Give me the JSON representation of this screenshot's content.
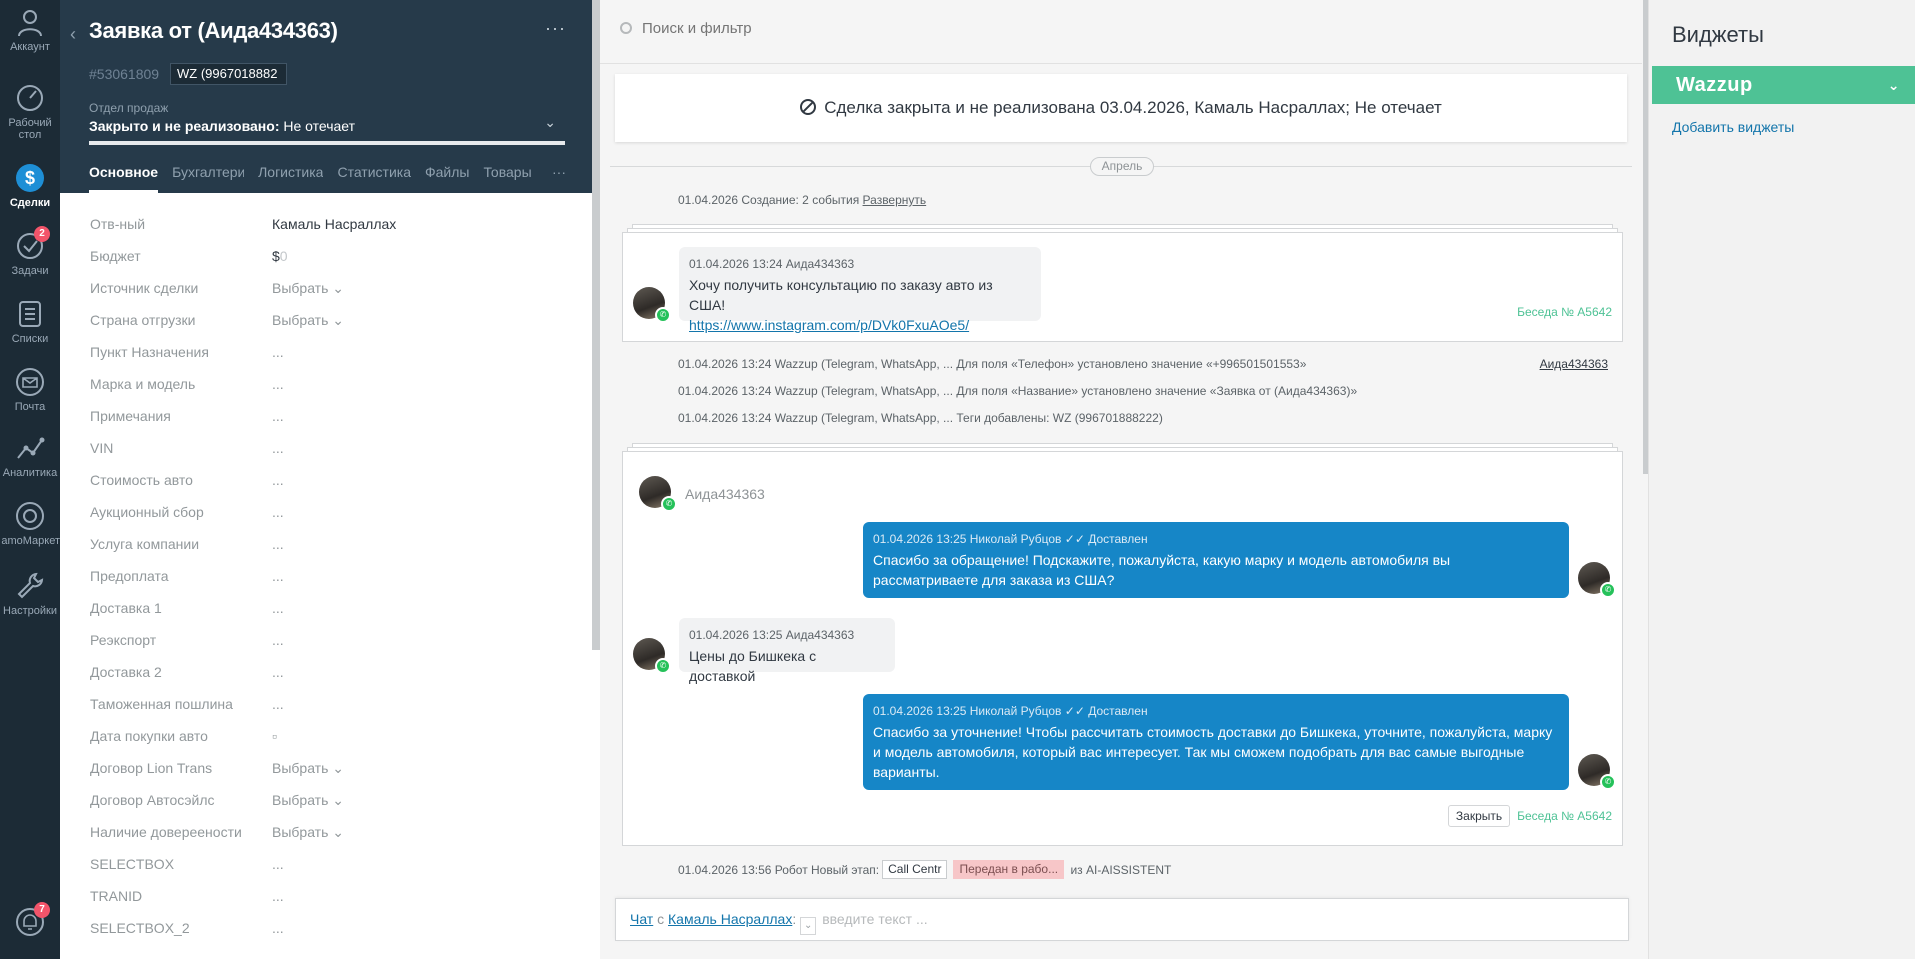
{
  "nav": {
    "items": [
      {
        "label": "Аккаунт",
        "icon": "user-icon"
      },
      {
        "label": "Рабочий стол",
        "icon": "dashboard-icon"
      },
      {
        "label": "Сделки",
        "icon": "deals-icon",
        "active": true
      },
      {
        "label": "Задачи",
        "icon": "tasks-icon",
        "badge": "2"
      },
      {
        "label": "Списки",
        "icon": "lists-icon"
      },
      {
        "label": "Почта",
        "icon": "mail-icon"
      },
      {
        "label": "Аналитика",
        "icon": "analytics-icon"
      },
      {
        "label": "amoМаркет",
        "icon": "market-icon"
      },
      {
        "label": "Настройки",
        "icon": "settings-icon"
      }
    ],
    "notifications_badge": "7"
  },
  "card": {
    "title": "Заявка от (Аида434363)",
    "id": "#53061809",
    "tag": "WZ (9967018882",
    "pipeline": "Отдел продаж",
    "status_bold": "Закрыто и не реализовано:",
    "status_reason": "Не отечает",
    "tabs": [
      "Основное",
      "Бухгалтерия",
      "Логистика",
      "Статистика",
      "Файлы",
      "Товары"
    ],
    "more": "···",
    "fields": [
      {
        "label": "Отв-ный",
        "value": "Камаль Насраллах"
      },
      {
        "label": "Бюджет",
        "value": "$",
        "zero": "0"
      },
      {
        "label": "Источник сделки",
        "value": "Выбрать"
      },
      {
        "label": "Страна отгрузки",
        "value": "Выбрать"
      },
      {
        "label": "Пункт Назначения",
        "value": "..."
      },
      {
        "label": "Марка и модель",
        "value": "..."
      },
      {
        "label": "Примечания",
        "value": "..."
      },
      {
        "label": "VIN",
        "value": "..."
      },
      {
        "label": "Стоимость авто",
        "value": "..."
      },
      {
        "label": "Аукционный сбор",
        "value": "..."
      },
      {
        "label": "Услуга компании",
        "value": "..."
      },
      {
        "label": "Предоплата",
        "value": "..."
      },
      {
        "label": "Доставка 1",
        "value": "..."
      },
      {
        "label": "Реэкспорт",
        "value": "..."
      },
      {
        "label": "Доставка 2",
        "value": "..."
      },
      {
        "label": "Таможенная пошлина",
        "value": "..."
      },
      {
        "label": "Дата покупки авто",
        "value": "▫"
      },
      {
        "label": "Договор Lion Trans",
        "value": "Выбрать"
      },
      {
        "label": "Договор Автосэйлс",
        "value": "Выбрать"
      },
      {
        "label": "Наличие довереености",
        "value": "Выбрать"
      },
      {
        "label": "SELECTBOX",
        "value": "..."
      },
      {
        "label": "TRANID",
        "value": "..."
      },
      {
        "label": "SELECTBOX_2",
        "value": "..."
      }
    ]
  },
  "feed": {
    "search_placeholder": "Поиск и фильтр",
    "closed_banner": "Сделка закрыта и не реализована 03.04.2026, Камаль Насраллах; Не отечает",
    "month": "Апрель",
    "creation_note": "01.04.2026 Создание: 2 события",
    "creation_expand": "Развернуть",
    "conv1": {
      "meta": "01.04.2026 13:24 Аида434363",
      "text": "Хочу получить консультацию по заказу авто из США!",
      "link": "https://www.instagram.com/p/DVk0FxuAOe5/",
      "number": "Беседа № A5642"
    },
    "notes": [
      "01.04.2026 13:24 Wazzup (Telegram, WhatsApp, ... Для поля «Телефон» установлено значение «+996501501553»",
      "01.04.2026 13:24 Wazzup (Telegram, WhatsApp, ... Для поля «Название» установлено значение «Заявка от (Аида434363)»",
      "01.04.2026 13:24 Wazzup (Telegram, WhatsApp, ... Теги добавлены: WZ (996701888222)"
    ],
    "notes_author": "Аида434363",
    "conv2": {
      "name": "Аида434363",
      "out1_meta": "01.04.2026 13:25 Николай Рубцов  ✓✓ Доставлен",
      "out1_text": "Спасибо за обращение! Подскажите, пожалуйста, какую марку и модель автомобиля вы рассматриваете для заказа из США?",
      "in_meta": "01.04.2026 13:25 Аида434363",
      "in_text": "Цены до Бишкека с доставкой",
      "out2_meta": "01.04.2026 13:25 Николай Рубцов  ✓✓ Доставлен",
      "out2_text": "Спасибо за уточнение! Чтобы рассчитать стоимость доставки до Бишкека, уточните, пожалуйста, марку и модель автомобиля, который вас интересует. Так мы сможем подобрать для вас самые выгодные варианты.",
      "close": "Закрыть",
      "number": "Беседа № A5642"
    },
    "robot_note": "01.04.2026 13:56 Робот Новый этап:",
    "stage_from": "Call Centr",
    "stage_to": "Передан в рабо...",
    "robot_from": "из AI-AISSISTENT",
    "composer": {
      "chat": "Чат",
      "with": "с",
      "person": "Камаль Насраллах",
      "colon": ":",
      "placeholder": "введите текст ..."
    }
  },
  "widgets": {
    "title": "Виджеты",
    "wazzup": "Wazzup",
    "add": "Добавить виджеты"
  },
  "colors": {
    "nav_bg": "#1c2b36",
    "card_header": "#263a4a",
    "accent_green": "#4ec295",
    "bubble_blue": "#1686c7",
    "link": "#1375ab"
  }
}
